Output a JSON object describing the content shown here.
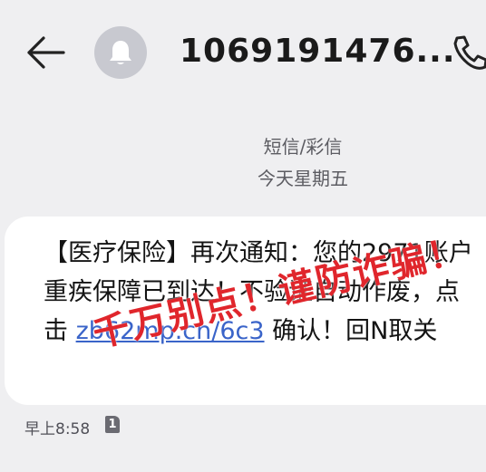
{
  "header": {
    "sender": "1069191476...",
    "back_icon": "arrow-left-icon",
    "avatar_icon": "bell-icon",
    "call_icon": "phone-icon"
  },
  "meta": {
    "message_type": "短信/彩信",
    "day": "今天星期五"
  },
  "message": {
    "part1": "【医疗保险】再次通知：您的2971账户重疾保障已到达！不验证自动作废，点击 ",
    "link": "zb62mp.cn/6c3",
    "part2": " 确认！回N取关",
    "link_color": "#3a64c9"
  },
  "watermark": {
    "text": "千万别点！谨防诈骗！",
    "color": "#e0262c"
  },
  "footer": {
    "time": "早上8:58",
    "sim_badge": "1"
  }
}
